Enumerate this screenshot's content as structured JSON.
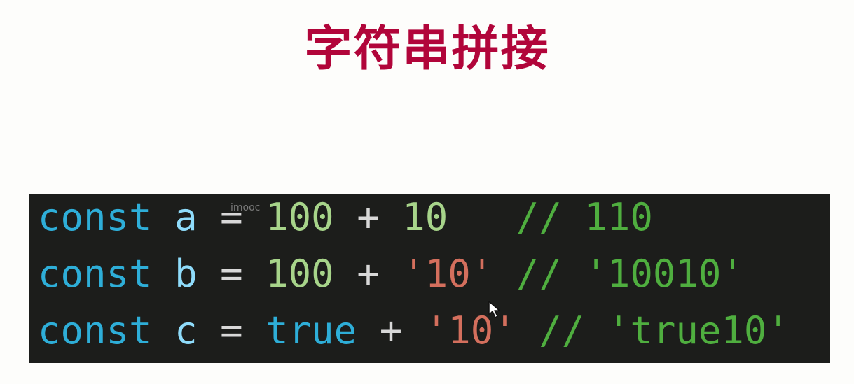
{
  "title": "字符串拼接",
  "watermark": "imooc",
  "code_lines": [
    {
      "keyword": "const",
      "variable": "a",
      "assign": "=",
      "left": "100",
      "plus": "+",
      "right": "10",
      "comment": "// 110"
    },
    {
      "keyword": "const",
      "variable": "b",
      "assign": "=",
      "left": "100",
      "plus": "+",
      "right": "'10'",
      "comment": "// '10010'"
    },
    {
      "keyword": "const",
      "variable": "c",
      "assign": "=",
      "left": "true",
      "plus": "+",
      "right": "'10'",
      "comment": "// 'true10'"
    }
  ],
  "colors": {
    "title": "#b1053a",
    "code_background": "#1c1d1b",
    "keyword": "#2eaed8",
    "variable": "#8fdcfb",
    "number": "#a7d48a",
    "string": "#d46f5d",
    "comment": "#4fae3f"
  },
  "icons": {
    "cursor": "mouse-cursor-icon"
  }
}
